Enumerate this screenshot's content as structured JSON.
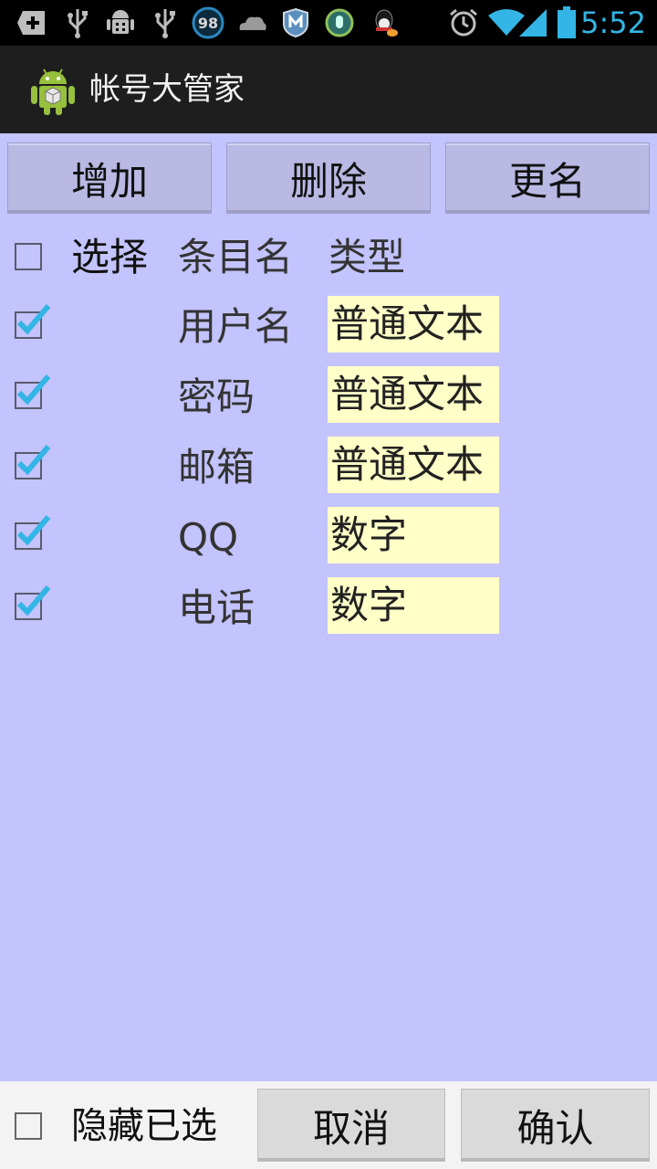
{
  "status_bar": {
    "time": "5:52",
    "badge_number": "98",
    "left_icons": [
      "add-box-icon",
      "usb-icon",
      "android-debug-icon",
      "usb-icon",
      "circle-98-icon",
      "cloud-icon",
      "shield-m-icon",
      "circle-app-icon",
      "qq-penguin-icon"
    ],
    "right_icons": [
      "alarm-icon",
      "wifi-icon",
      "signal-icon",
      "battery-icon"
    ]
  },
  "action_bar": {
    "title": "帐号大管家",
    "logo_icon": "android-logo-icon"
  },
  "toolbar": {
    "add_label": "增加",
    "delete_label": "删除",
    "rename_label": "更名"
  },
  "list_header": {
    "select_label": "选择",
    "name_label": "条目名",
    "type_label": "类型",
    "checked": false
  },
  "items": [
    {
      "name": "用户名",
      "type": "普通文本",
      "checked": true
    },
    {
      "name": "密码",
      "type": "普通文本",
      "checked": true
    },
    {
      "name": "邮箱",
      "type": "普通文本",
      "checked": true
    },
    {
      "name": "QQ",
      "type": "数字",
      "checked": true
    },
    {
      "name": "电话",
      "type": "数字",
      "checked": true
    }
  ],
  "bottom_bar": {
    "hide_selected_label": "隐藏已选",
    "hide_checked": false,
    "cancel_label": "取消",
    "confirm_label": "确认"
  },
  "colors": {
    "background": "#c3c3fd",
    "type_field": "#ffffc8",
    "check_blue": "#33b5e5",
    "status_time": "#33b5e5",
    "action_bar": "#1e1e1e"
  }
}
